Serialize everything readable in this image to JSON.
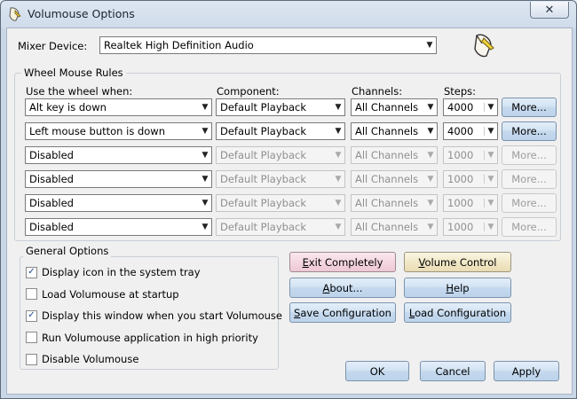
{
  "window": {
    "title": "Volumouse Options",
    "close_glyph": "✕"
  },
  "mixer": {
    "label": "Mixer Device:",
    "value": "Realtek High Definition Audio"
  },
  "rules": {
    "group_title": "Wheel Mouse Rules",
    "headers": {
      "use_wheel": "Use the wheel when:",
      "component": "Component:",
      "channels": "Channels:",
      "steps": "Steps:"
    },
    "rows": [
      {
        "condition": "Alt key is down",
        "component": "Default Playback",
        "channels": "All Channels",
        "steps": "4000",
        "more": "More...",
        "enabled": true
      },
      {
        "condition": "Left mouse button is down",
        "component": "Default Playback",
        "channels": "All Channels",
        "steps": "4000",
        "more": "More...",
        "enabled": true
      },
      {
        "condition": "Disabled",
        "component": "Default Playback",
        "channels": "All Channels",
        "steps": "1000",
        "more": "More...",
        "enabled": false
      },
      {
        "condition": "Disabled",
        "component": "Default Playback",
        "channels": "All Channels",
        "steps": "1000",
        "more": "More...",
        "enabled": false
      },
      {
        "condition": "Disabled",
        "component": "Default Playback",
        "channels": "All Channels",
        "steps": "1000",
        "more": "More...",
        "enabled": false
      },
      {
        "condition": "Disabled",
        "component": "Default Playback",
        "channels": "All Channels",
        "steps": "1000",
        "more": "More...",
        "enabled": false
      }
    ]
  },
  "general": {
    "group_title": "General Options",
    "options": [
      {
        "label": "Display icon in the system tray",
        "checked": true
      },
      {
        "label": "Load Volumouse at startup",
        "checked": false
      },
      {
        "label": "Display this window when you start Volumouse",
        "checked": true
      },
      {
        "label": "Run Volumouse application in high priority",
        "checked": false
      },
      {
        "label": "Disable Volumouse",
        "checked": false
      }
    ]
  },
  "actions": {
    "exit": {
      "mnemonic": "E",
      "rest": "xit Completely"
    },
    "volume_control": {
      "mnemonic": "V",
      "rest": "olume Control"
    },
    "about": {
      "mnemonic": "A",
      "rest": "bout..."
    },
    "help": {
      "mnemonic": "H",
      "rest": "elp"
    },
    "save": {
      "mnemonic": "S",
      "rest": "ave Configuration"
    },
    "load": {
      "mnemonic": "L",
      "rest": "oad Configuration"
    }
  },
  "footer": {
    "ok": "OK",
    "cancel": "Cancel",
    "apply": "Apply"
  },
  "icons": {
    "app": "mouse-volume-icon",
    "check": "✓",
    "dropdown": "▼"
  }
}
